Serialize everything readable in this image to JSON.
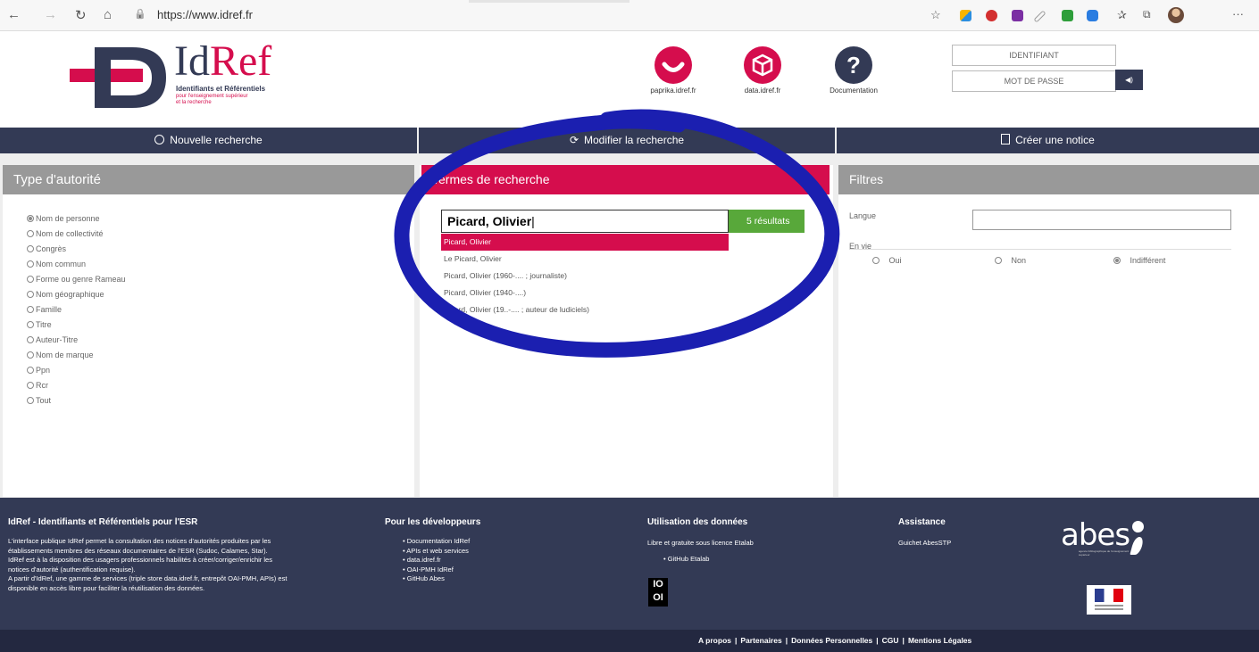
{
  "browser": {
    "url": "https://www.idref.fr",
    "back": "←",
    "forward": "→",
    "reload": "↻",
    "home": "⌂",
    "lock": "🔒",
    "star": "☆",
    "favorites": "✰",
    "collections": "⧉",
    "more": "···"
  },
  "header": {
    "logo_title": "IdRef",
    "logo_subtitle": "Identifiants et Référentiels",
    "logo_sub2": "pour l'enseignement supérieur",
    "logo_sub3": "et la recherche",
    "services": [
      {
        "label": "paprika.idref.fr",
        "color": "#d50d4d"
      },
      {
        "label": "data.idref.fr",
        "color": "#d50d4d"
      },
      {
        "label": "Documentation",
        "color": "#333a55"
      }
    ],
    "identifiant_placeholder": "IDENTIFIANT",
    "password_placeholder": "MOT DE PASSE",
    "login_icon": "◀)"
  },
  "nav": {
    "items": [
      {
        "label": "Nouvelle recherche",
        "icon": "search-icon"
      },
      {
        "label": "Modifier la recherche",
        "icon": "refresh-icon"
      },
      {
        "label": "Créer une notice",
        "icon": "document-icon"
      }
    ]
  },
  "type_autorite": {
    "title": "Type d'autorité",
    "options": [
      {
        "label": "Nom de personne",
        "selected": true
      },
      {
        "label": "Nom de collectivité",
        "selected": false
      },
      {
        "label": "Congrès",
        "selected": false
      },
      {
        "label": "Nom commun",
        "selected": false
      },
      {
        "label": "Forme ou genre Rameau",
        "selected": false
      },
      {
        "label": "Nom géographique",
        "selected": false
      },
      {
        "label": "Famille",
        "selected": false
      },
      {
        "label": "Titre",
        "selected": false
      },
      {
        "label": "Auteur-Titre",
        "selected": false
      },
      {
        "label": "Nom de marque",
        "selected": false
      },
      {
        "label": "Ppn",
        "selected": false
      },
      {
        "label": "Rcr",
        "selected": false
      },
      {
        "label": "Tout",
        "selected": false
      }
    ]
  },
  "search": {
    "title": "Termes de recherche",
    "value": "Picard, Olivier",
    "results_label": "5 résultats",
    "suggestions": [
      {
        "label": "Picard, Olivier",
        "active": true
      },
      {
        "label": "Le Picard, Olivier",
        "active": false
      },
      {
        "label": "Picard, Olivier (1960-.... ; journaliste)",
        "active": false
      },
      {
        "label": "Picard, Olivier (1940-....)",
        "active": false
      },
      {
        "label": "Picard, Olivier (19..-.... ; auteur de ludiciels)",
        "active": false
      }
    ]
  },
  "filters": {
    "title": "Filtres",
    "langue_label": "Langue",
    "langue_value": "",
    "envie_label": "En vie",
    "options": [
      {
        "label": "Oui",
        "selected": false
      },
      {
        "label": "Non",
        "selected": false
      },
      {
        "label": "Indifférent",
        "selected": true
      }
    ]
  },
  "footer": {
    "col1_title": "IdRef - Identifiants et Référentiels pour l'ESR",
    "col1_lines": [
      "L'interface publique IdRef permet la consultation des notices d'autorités produites par les",
      "établissements membres des réseaux documentaires de l'ESR (Sudoc, Calames, Star).",
      "IdRef est à la disposition des usagers professionnels habilités à créer/corriger/enrichir les",
      "notices d'autorité (authentification requise).",
      "A partir d'IdRef, une gamme de services (triple store data.idref.fr, entrepôt OAI-PMH, APIs) est",
      "disponible en accès libre pour faciliter la réutilisation des données."
    ],
    "col2_title": "Pour les développeurs",
    "col2_links": [
      "Documentation IdRef",
      "APIs et web services",
      "data.idref.fr",
      "OAI-PMH IdRef",
      "GitHub Abes"
    ],
    "col3_title": "Utilisation des données",
    "col3_text": "Libre et gratuite sous licence Etalab",
    "col3_links": [
      "GitHub Etalab"
    ],
    "col3_badge_top": "IO",
    "col3_badge_bottom": "OI",
    "col4_title": "Assistance",
    "col4_link": "Guichet AbesSTP",
    "abes_logo": "abes",
    "abes_sub": "agence bibliographique de l'enseignement supérieur",
    "bottom_links": [
      "A propos",
      "Partenaires",
      "Données Personnelles",
      "CGU",
      "Mentions Légales"
    ],
    "bottom_sep": "|"
  },
  "colors": {
    "navy": "#333a55",
    "crimson": "#d50d4d",
    "green": "#58a83a",
    "grey_header": "#999999",
    "annotation_blue": "#1b1fb0"
  }
}
